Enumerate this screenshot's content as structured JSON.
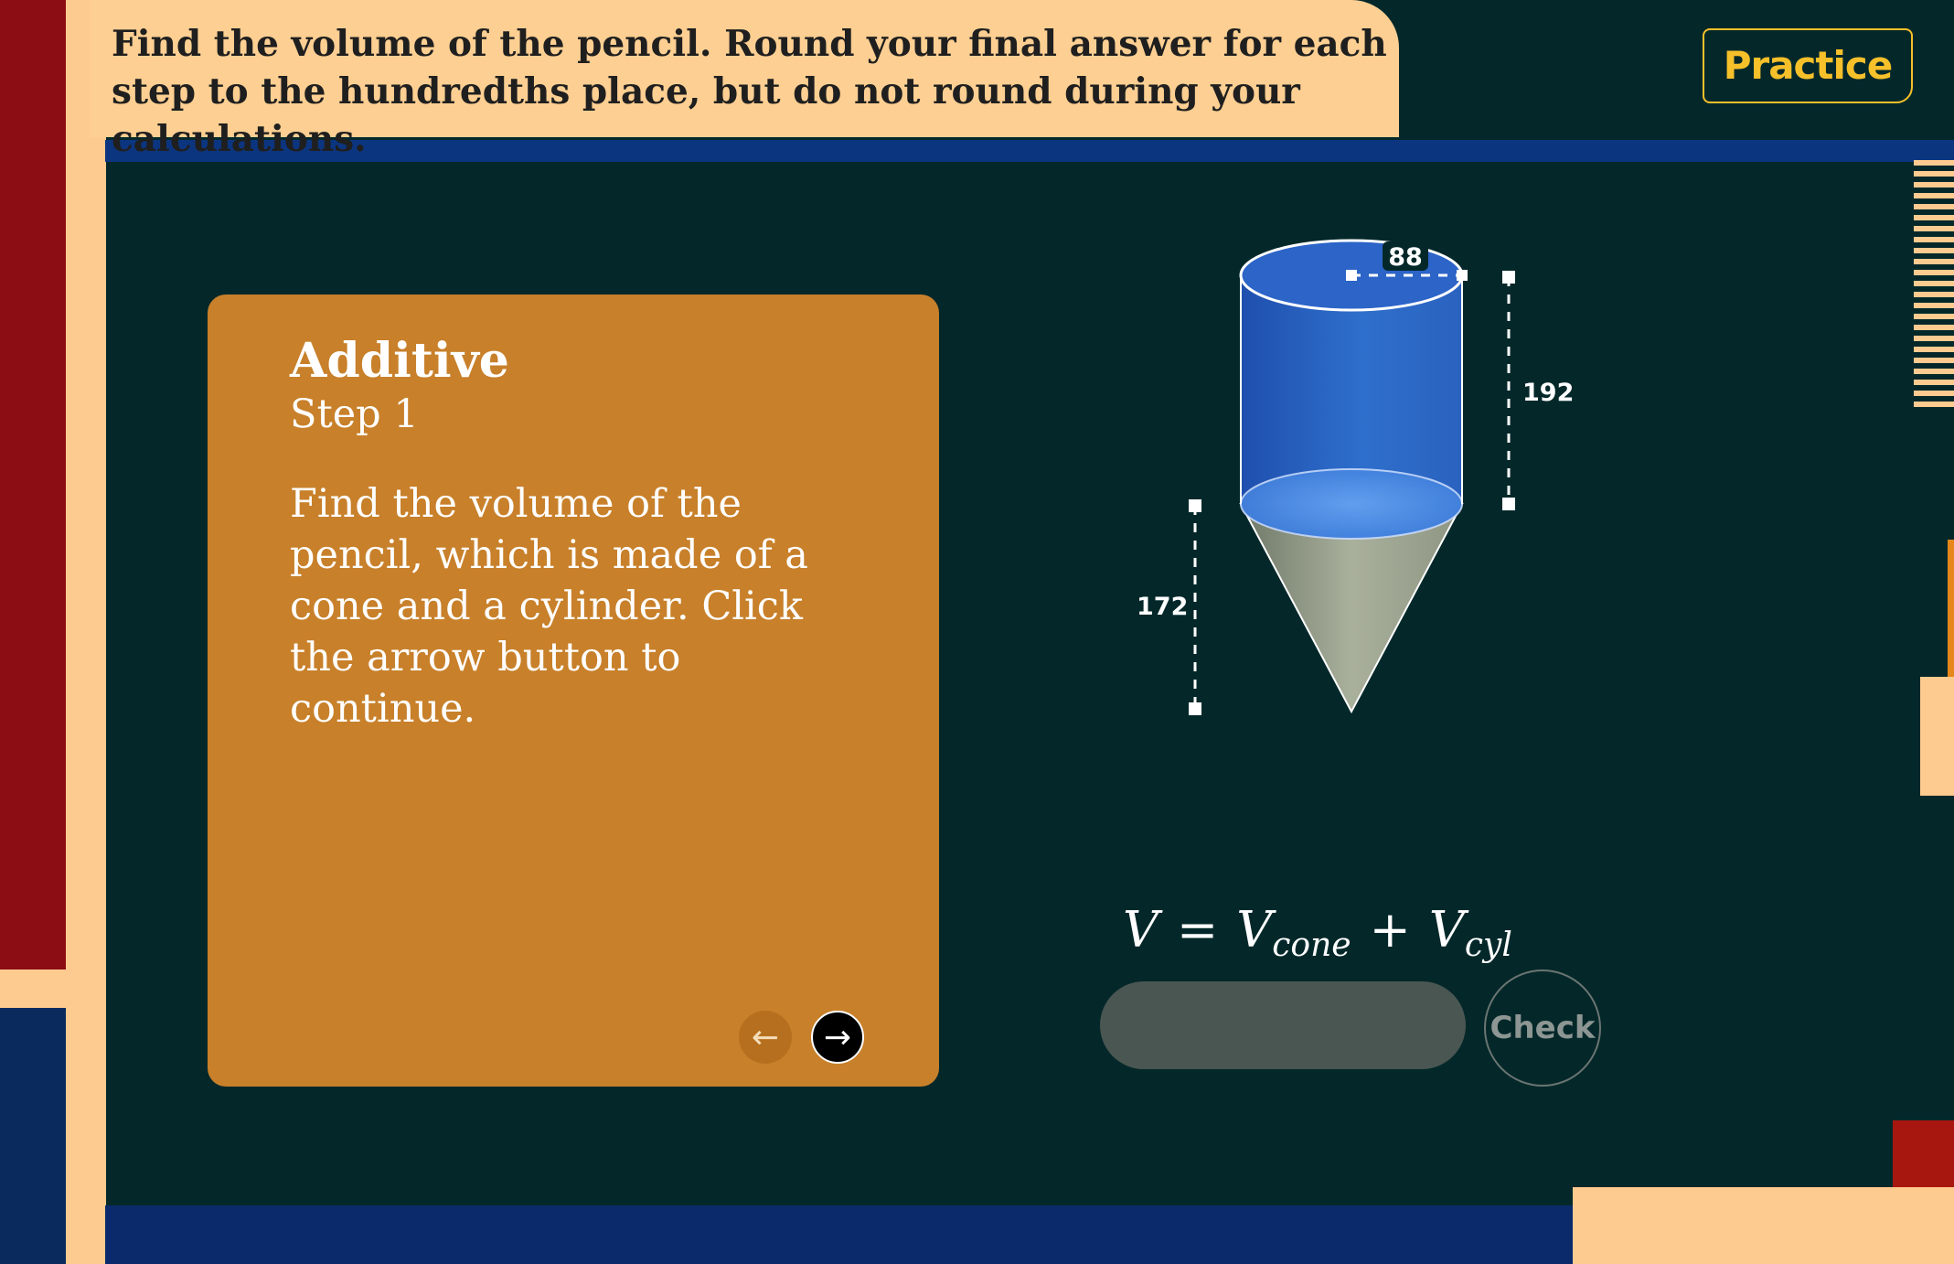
{
  "instructions": "Find the volume of the pencil. Round your final answer for each step to the hundredths place, but do not round during your calculations.",
  "badge": "Practice",
  "card": {
    "title": "Additive",
    "step": "Step 1",
    "body": "Find the volume of the pencil, which is made of a cone and a cylinder. Click the arrow button to continue.",
    "prev_icon": "←",
    "next_icon": "→"
  },
  "diagram": {
    "diameter_label": "88",
    "cylinder_height_label": "192",
    "cone_height_label": "172"
  },
  "formula": {
    "lhs": "V",
    "eq": "=",
    "v1": "V",
    "sub1": "cone",
    "plus": "+",
    "v2": "V",
    "sub2": "cyl"
  },
  "answer": {
    "value": "",
    "placeholder": ""
  },
  "check_label": "Check",
  "colors": {
    "background": "#04282a",
    "card": "#c8802a",
    "banner": "#fdcf92",
    "badge": "#f6c02a",
    "cylinder": "#2a67c4",
    "cone": "#9da592"
  }
}
